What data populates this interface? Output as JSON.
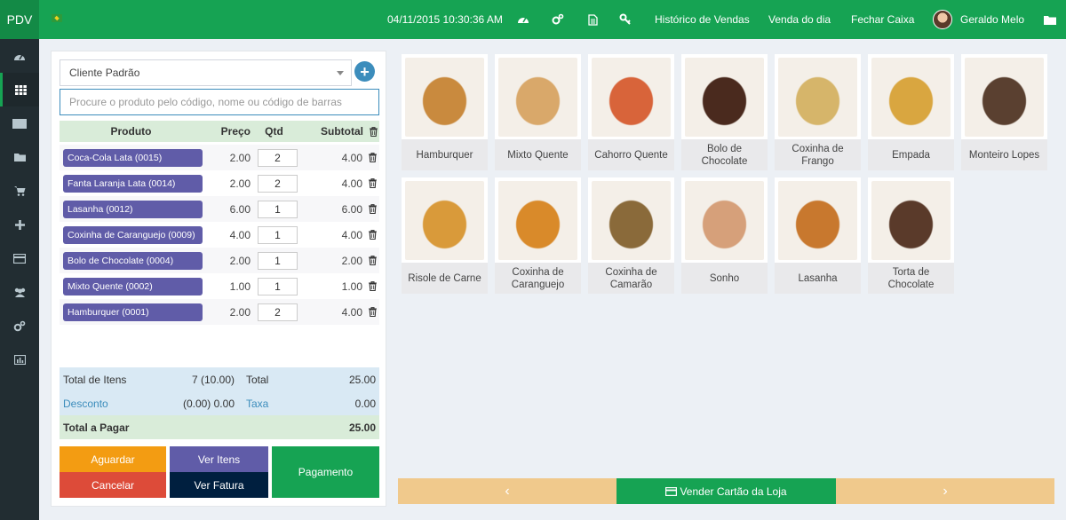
{
  "app": {
    "brand": "PDV",
    "datetime": "04/11/2015 10:30:36 AM"
  },
  "topnav": {
    "historico": "Histórico de Vendas",
    "venda_dia": "Venda do dia",
    "fechar_caixa": "Fechar Caixa",
    "user_name": "Geraldo Melo"
  },
  "sidebar": {
    "active_index": 1,
    "icons": [
      "dashboard-icon",
      "grid-icon",
      "barcode-icon",
      "folder-icon",
      "cart-icon",
      "plus-icon",
      "credit-card-icon",
      "users-icon",
      "cogs-icon",
      "chart-icon"
    ]
  },
  "customer": {
    "selected": "Cliente Padrão"
  },
  "search": {
    "placeholder": "Procure o produto pelo código, nome ou código de barras"
  },
  "table": {
    "headers": {
      "produto": "Produto",
      "preco": "Preço",
      "qtd": "Qtd",
      "subtotal": "Subtotal"
    },
    "rows": [
      {
        "name": "Coca-Cola Lata (0015)",
        "price": "2.00",
        "qty": "2",
        "subtotal": "4.00"
      },
      {
        "name": "Fanta Laranja Lata (0014)",
        "price": "2.00",
        "qty": "2",
        "subtotal": "4.00"
      },
      {
        "name": "Lasanha (0012)",
        "price": "6.00",
        "qty": "1",
        "subtotal": "6.00"
      },
      {
        "name": "Coxinha de Caranguejo (0009)",
        "price": "4.00",
        "qty": "1",
        "subtotal": "4.00"
      },
      {
        "name": "Bolo de Chocolate (0004)",
        "price": "2.00",
        "qty": "1",
        "subtotal": "2.00"
      },
      {
        "name": "Mixto Quente (0002)",
        "price": "1.00",
        "qty": "1",
        "subtotal": "1.00"
      },
      {
        "name": "Hamburquer (0001)",
        "price": "2.00",
        "qty": "2",
        "subtotal": "4.00"
      }
    ]
  },
  "totals": {
    "total_itens_label": "Total de Itens",
    "total_itens_value": "7 (10.00)",
    "total_label": "Total",
    "total_value": "25.00",
    "desconto_label": "Desconto",
    "desconto_value": "(0.00) 0.00",
    "taxa_label": "Taxa",
    "taxa_value": "0.00",
    "pagar_label": "Total a Pagar",
    "pagar_value": "25.00"
  },
  "actions": {
    "aguardar": "Aguardar",
    "ver_itens": "Ver Itens",
    "pagamento": "Pagamento",
    "cancelar": "Cancelar",
    "ver_fatura": "Ver Fatura"
  },
  "products": [
    {
      "name": "Hamburquer",
      "color": "#c98a3e"
    },
    {
      "name": "Mixto Quente",
      "color": "#d9a86a"
    },
    {
      "name": "Cahorro Quente",
      "color": "#d8643a"
    },
    {
      "name": "Bolo de Chocolate",
      "color": "#4a2a1e"
    },
    {
      "name": "Coxinha de Frango",
      "color": "#d6b56a"
    },
    {
      "name": "Empada",
      "color": "#d9a640"
    },
    {
      "name": "Monteiro Lopes",
      "color": "#5a4030"
    },
    {
      "name": "Risole de Carne",
      "color": "#d99a3a"
    },
    {
      "name": "Coxinha de Caranguejo",
      "color": "#d98a2a"
    },
    {
      "name": "Coxinha de Camarão",
      "color": "#8a6a3a"
    },
    {
      "name": "Sonho",
      "color": "#d6a07a"
    },
    {
      "name": "Lasanha",
      "color": "#c8782e"
    },
    {
      "name": "Torta de Chocolate",
      "color": "#5a3a2a"
    }
  ],
  "bottom": {
    "prev": "‹",
    "store_card": "Vender Cartão da Loja",
    "next": "›"
  }
}
